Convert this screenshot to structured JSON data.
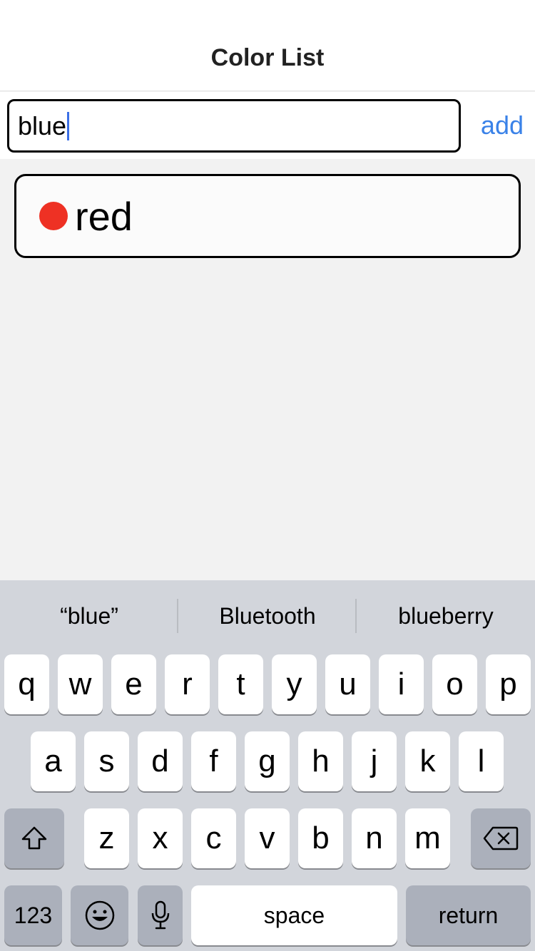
{
  "nav": {
    "title": "Color List"
  },
  "input": {
    "value": "blue",
    "add_label": "add"
  },
  "list": {
    "items": [
      {
        "label": "red",
        "color": "#ee3124"
      }
    ]
  },
  "keyboard": {
    "suggestions": [
      "“blue”",
      "Bluetooth",
      "blueberry"
    ],
    "row1": [
      "q",
      "w",
      "e",
      "r",
      "t",
      "y",
      "u",
      "i",
      "o",
      "p"
    ],
    "row2": [
      "a",
      "s",
      "d",
      "f",
      "g",
      "h",
      "j",
      "k",
      "l"
    ],
    "row3": [
      "z",
      "x",
      "c",
      "v",
      "b",
      "n",
      "m"
    ],
    "numbers_label": "123",
    "space_label": "space",
    "return_label": "return",
    "icons": {
      "shift": "shift-icon",
      "delete": "delete-icon",
      "emoji": "emoji-icon",
      "mic": "microphone-icon"
    }
  }
}
